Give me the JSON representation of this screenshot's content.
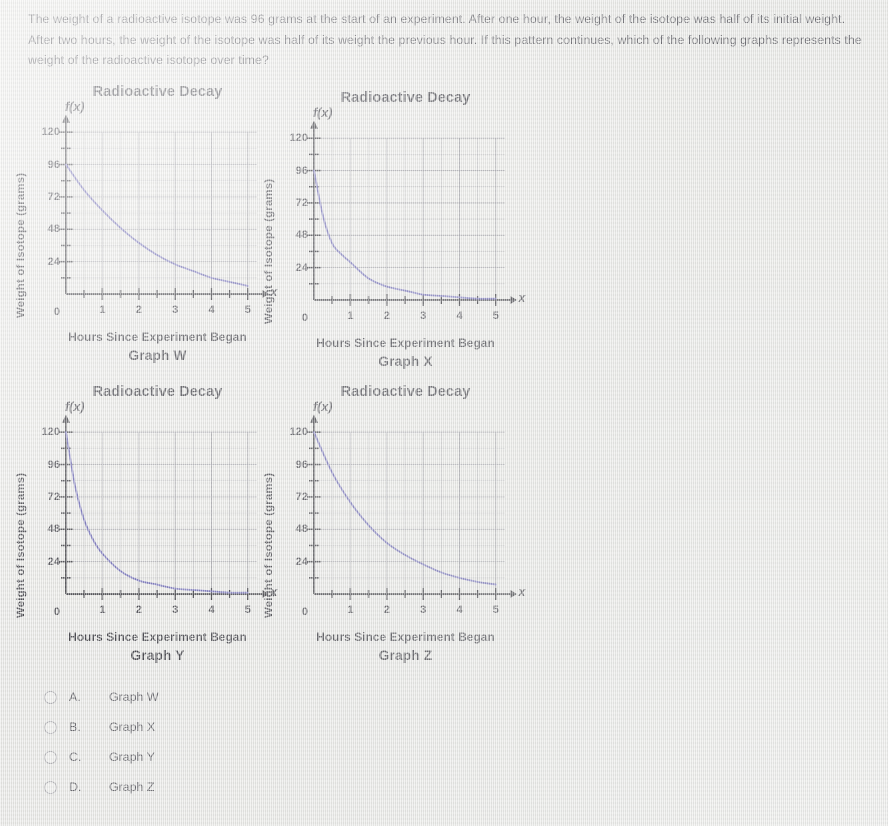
{
  "question": {
    "stem": "The weight of a radioactive isotope was 96 grams at the start of an experiment. After one hour, the weight of the isotope was half of its initial weight. After two hours, the weight of the isotope was half of its weight the previous hour. If this pattern continues, which of the following graphs represents the weight of the radioactive isotope over time?"
  },
  "common": {
    "chart_title": "Radioactive Decay",
    "axis_symbol": "f(x)",
    "x_axis_symbol": "x",
    "ylabel": "Weight of Isotope (grams)",
    "xlabel": "Hours Since Experiment Began",
    "yticks": [
      "120",
      "96",
      "72",
      "48",
      "24",
      "0"
    ],
    "xticks": [
      "1",
      "2",
      "3",
      "4",
      "5"
    ],
    "origin_label": "0",
    "curve_color": "#6a66b6",
    "axis_color": "#26262c",
    "grid_color": "#8d8d95"
  },
  "graphs": [
    {
      "id": "W",
      "name": "Graph W"
    },
    {
      "id": "X",
      "name": "Graph X"
    },
    {
      "id": "Y",
      "name": "Graph Y"
    },
    {
      "id": "Z",
      "name": "Graph Z"
    }
  ],
  "options": [
    {
      "letter": "A.",
      "text": "Graph W"
    },
    {
      "letter": "B.",
      "text": "Graph X"
    },
    {
      "letter": "C.",
      "text": "Graph Y"
    },
    {
      "letter": "D.",
      "text": "Graph Z"
    }
  ],
  "chart_data": [
    {
      "type": "line",
      "id": "W",
      "title": "Radioactive Decay",
      "subtitle": "Graph W",
      "xlabel": "Hours Since Experiment Began",
      "ylabel": "Weight of Isotope (grams)",
      "xlim": [
        0,
        5.5
      ],
      "ylim": [
        0,
        132
      ],
      "xticks": [
        1,
        2,
        3,
        4,
        5
      ],
      "yticks": [
        0,
        24,
        48,
        72,
        96,
        120
      ],
      "grid": true,
      "legend": "none",
      "x": [
        0,
        0.5,
        1,
        1.5,
        2,
        2.5,
        3,
        3.5,
        4,
        4.5,
        5
      ],
      "y": [
        96,
        77,
        62,
        49,
        38,
        29,
        22,
        17,
        12,
        9,
        6
      ]
    },
    {
      "type": "line",
      "id": "X",
      "title": "Radioactive Decay",
      "subtitle": "Graph X",
      "xlabel": "Hours Since Experiment Began",
      "ylabel": "Weight of Isotope (grams)",
      "xlim": [
        0,
        5.5
      ],
      "ylim": [
        0,
        132
      ],
      "xticks": [
        1,
        2,
        3,
        4,
        5
      ],
      "yticks": [
        0,
        24,
        48,
        72,
        96,
        120
      ],
      "grid": true,
      "legend": "none",
      "x": [
        0,
        0.25,
        0.5,
        0.75,
        1,
        1.5,
        2,
        2.5,
        3,
        3.5,
        4,
        4.5,
        5
      ],
      "y": [
        96,
        62,
        42,
        34,
        28,
        16,
        10,
        7,
        4,
        3,
        2,
        1,
        1
      ]
    },
    {
      "type": "line",
      "id": "Y",
      "title": "Radioactive Decay",
      "subtitle": "Graph Y",
      "xlabel": "Hours Since Experiment Began",
      "ylabel": "Weight of Isotope (grams)",
      "xlim": [
        0,
        5.5
      ],
      "ylim": [
        0,
        132
      ],
      "xticks": [
        1,
        2,
        3,
        4,
        5
      ],
      "yticks": [
        0,
        24,
        48,
        72,
        96,
        120
      ],
      "grid": true,
      "legend": "none",
      "x": [
        0,
        0.25,
        0.5,
        0.75,
        1,
        1.5,
        2,
        2.5,
        3,
        3.5,
        4,
        4.5,
        5
      ],
      "y": [
        120,
        80,
        55,
        40,
        30,
        17,
        10,
        7,
        4,
        3,
        2,
        1,
        1
      ]
    },
    {
      "type": "line",
      "id": "Z",
      "title": "Radioactive Decay",
      "subtitle": "Graph Z",
      "xlabel": "Hours Since Experiment Began",
      "ylabel": "Weight of Isotope (grams)",
      "xlim": [
        0,
        5.5
      ],
      "ylim": [
        0,
        132
      ],
      "xticks": [
        1,
        2,
        3,
        4,
        5
      ],
      "yticks": [
        0,
        24,
        48,
        72,
        96,
        120
      ],
      "grid": true,
      "legend": "none",
      "x": [
        0,
        0.5,
        1,
        1.5,
        2,
        2.5,
        3,
        3.5,
        4,
        4.5,
        5
      ],
      "y": [
        120,
        90,
        68,
        51,
        38,
        29,
        22,
        16,
        12,
        9,
        7
      ]
    }
  ]
}
